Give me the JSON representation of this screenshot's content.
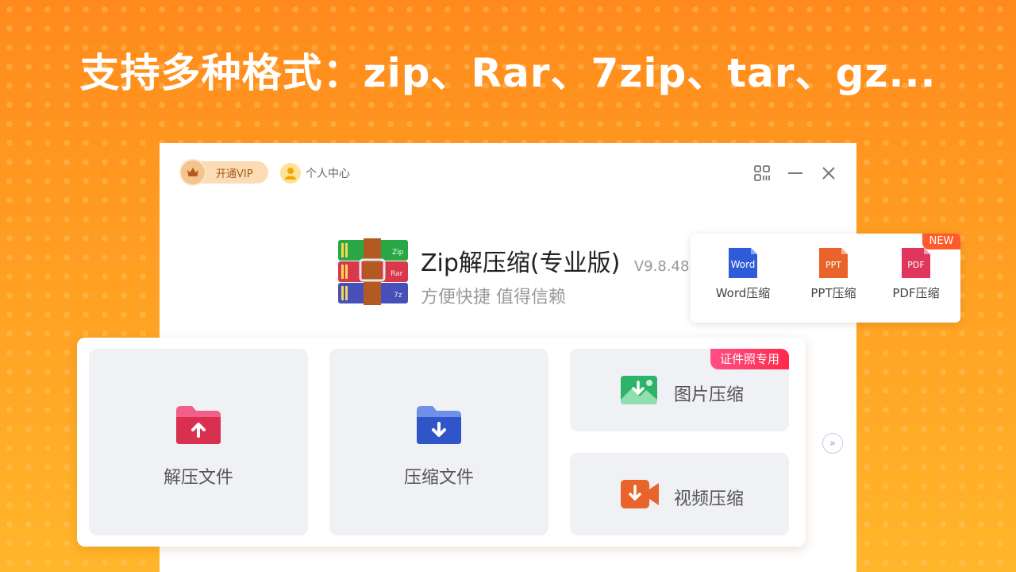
{
  "headline": "支持多种格式：zip、Rar、7zip、tar、gz...",
  "titlebar": {
    "vip_label": "开通VIP",
    "user_center_label": "个人中心"
  },
  "app": {
    "name": "Zip解压缩(专业版)",
    "version": "V9.8.48",
    "subtitle": "方便快捷 值得信赖",
    "logo_labels": [
      "Zip",
      "Rar",
      "7z"
    ]
  },
  "quick_tools": {
    "badge": "NEW",
    "items": [
      {
        "label": "Word压缩",
        "icon_text": "Word",
        "color": "#2f5bd8"
      },
      {
        "label": "PPT压缩",
        "icon_text": "PPT",
        "color": "#e8642a"
      },
      {
        "label": "PDF压缩",
        "icon_text": "PDF",
        "color": "#e0365e"
      }
    ]
  },
  "main_actions": {
    "extract": {
      "label": "解压文件",
      "icon": "folder-upload-icon"
    },
    "compress": {
      "label": "压缩文件",
      "icon": "folder-download-icon"
    },
    "image": {
      "label": "图片压缩",
      "badge": "证件照专用",
      "icon": "image-download-icon"
    },
    "video": {
      "label": "视频压缩",
      "icon": "video-download-icon"
    }
  },
  "colors": {
    "background_top": "#ff8a1c",
    "background_bottom": "#ffb62a",
    "accent_badge": "#ff2a4a",
    "new_badge": "#ff5a2a"
  }
}
